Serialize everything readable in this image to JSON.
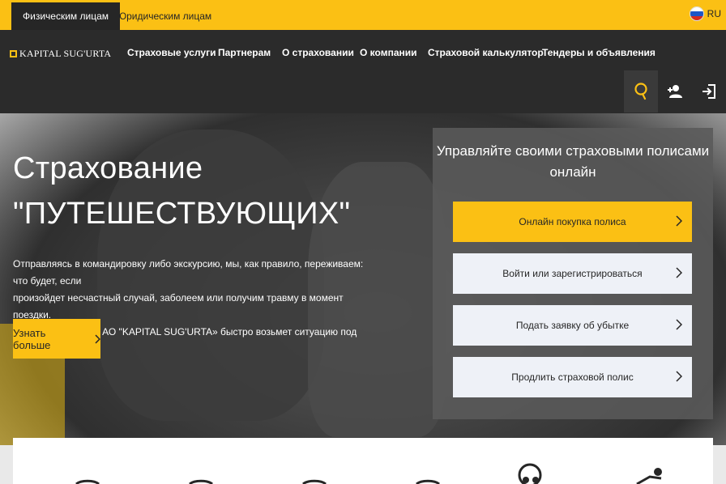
{
  "topbar": {
    "tab_individuals": "Физическим лицам",
    "tab_legal": "Юридическим лицам",
    "lang": "RU"
  },
  "nav": {
    "logo": "KAPITAL SUG'URTA",
    "menu": [
      "Страховые услуги",
      "Партнерам",
      "О страховании",
      "О компании",
      "Страховой калькулятор",
      "Тендеры и объявления"
    ],
    "icons": [
      "search-icon",
      "add-user-icon",
      "login-icon"
    ]
  },
  "hero": {
    "title_line1": "Страхование",
    "title_line2": "\"ПУТЕШЕСТВУЮЩИХ\"",
    "text_line1": "Отправляясь в командировку либо экскурсию, мы, как правило, переживаем: что будет, если",
    "text_line2": "произойдет несчастный случай, заболеем или получим травму в момент поездки.",
    "text_line3": "Служба поддержки АО \"KAPITAL SUG'URTA» быстро возьмет ситуацию под контроль.",
    "more_button": "Узнать больше"
  },
  "panel": {
    "title_line1": "Управляйте своими страховыми полисами",
    "title_line2": "онлайн",
    "buttons": [
      "Онлайн покупка полиса",
      "Войти или зарегистрироваться",
      "Подать заявку об убытке",
      "Продлить страховой полис"
    ]
  },
  "colors": {
    "accent": "#fbc014",
    "dark": "#262626",
    "nav_bg": "#2b2b2b"
  }
}
